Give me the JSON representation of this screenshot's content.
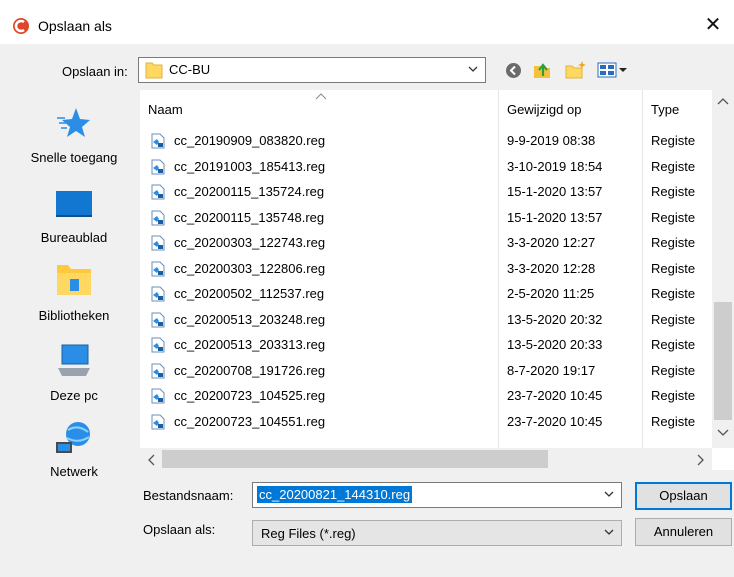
{
  "dialog": {
    "title": "Opslaan als",
    "close_glyph": "✕"
  },
  "location": {
    "label": "Opslaan in:",
    "value": "CC-BU"
  },
  "places": [
    {
      "id": "quick",
      "label": "Snelle toegang",
      "icon": "star-icon"
    },
    {
      "id": "desktop",
      "label": "Bureaublad",
      "icon": "desktop-icon"
    },
    {
      "id": "libraries",
      "label": "Bibliotheken",
      "icon": "libraries-icon"
    },
    {
      "id": "thispc",
      "label": "Deze pc",
      "icon": "computer-icon"
    },
    {
      "id": "network",
      "label": "Netwerk",
      "icon": "network-icon"
    }
  ],
  "columns": {
    "name": "Naam",
    "modified": "Gewijzigd op",
    "type": "Type"
  },
  "files": [
    {
      "name": "cc_20190909_083820.reg",
      "modified": "9-9-2019 08:38",
      "type": "Registe"
    },
    {
      "name": "cc_20191003_185413.reg",
      "modified": "3-10-2019 18:54",
      "type": "Registe"
    },
    {
      "name": "cc_20200115_135724.reg",
      "modified": "15-1-2020 13:57",
      "type": "Registe"
    },
    {
      "name": "cc_20200115_135748.reg",
      "modified": "15-1-2020 13:57",
      "type": "Registe"
    },
    {
      "name": "cc_20200303_122743.reg",
      "modified": "3-3-2020 12:27",
      "type": "Registe"
    },
    {
      "name": "cc_20200303_122806.reg",
      "modified": "3-3-2020 12:28",
      "type": "Registe"
    },
    {
      "name": "cc_20200502_112537.reg",
      "modified": "2-5-2020 11:25",
      "type": "Registe"
    },
    {
      "name": "cc_20200513_203248.reg",
      "modified": "13-5-2020 20:32",
      "type": "Registe"
    },
    {
      "name": "cc_20200513_203313.reg",
      "modified": "13-5-2020 20:33",
      "type": "Registe"
    },
    {
      "name": "cc_20200708_191726.reg",
      "modified": "8-7-2020 19:17",
      "type": "Registe"
    },
    {
      "name": "cc_20200723_104525.reg",
      "modified": "23-7-2020 10:45",
      "type": "Registe"
    },
    {
      "name": "cc_20200723_104551.reg",
      "modified": "23-7-2020 10:45",
      "type": "Registe"
    }
  ],
  "filename": {
    "label": "Bestandsnaam:",
    "value": "cc_20200821_144310.reg"
  },
  "filetype": {
    "label": "Opslaan als:",
    "value": "Reg Files (*.reg)"
  },
  "buttons": {
    "save": "Opslaan",
    "cancel": "Annuleren"
  },
  "colors": {
    "accent": "#0078d7",
    "selection": "#0078d7",
    "folder": "#ffd862"
  }
}
